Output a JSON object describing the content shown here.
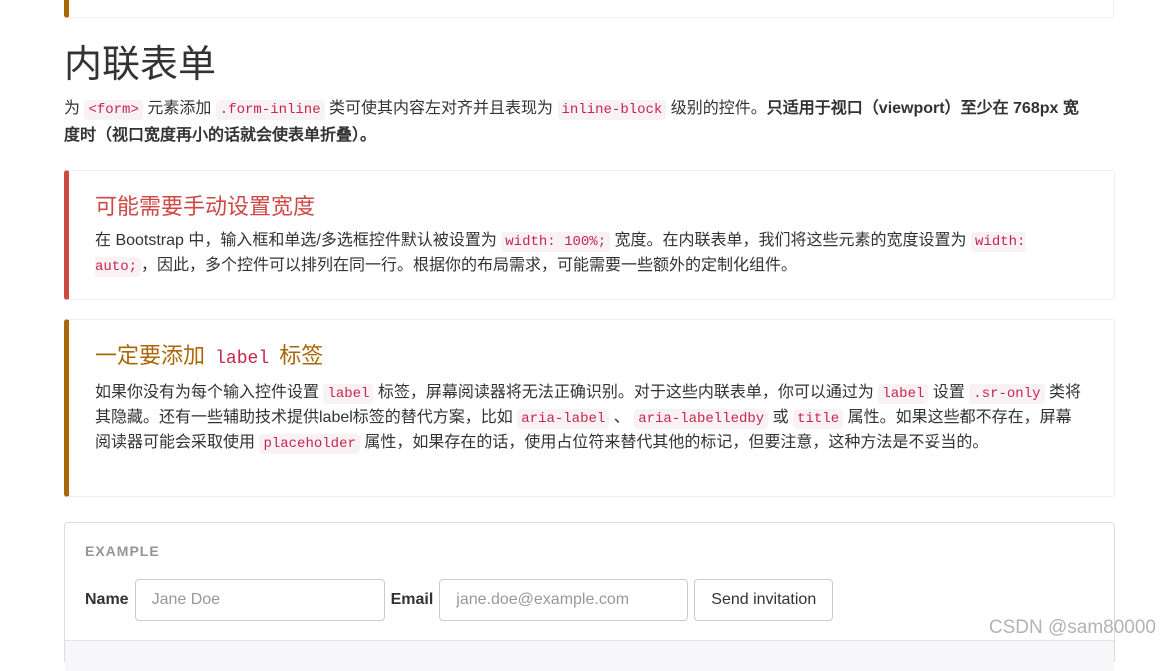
{
  "section": {
    "title": "内联表单",
    "intro": {
      "p1": "为 ",
      "code1": "<form>",
      "p2": " 元素添加 ",
      "code2": ".form-inline",
      "p3": " 类可使其内容左对齐并且表现为 ",
      "code3": "inline-block",
      "p4": " 级别的控件。",
      "strong": "只适用于视口（viewport）至少在 768px 宽度时（视口宽度再小的话就会使表单折叠）。"
    }
  },
  "callout_danger": {
    "title": "可能需要手动设置宽度",
    "t1": "在 Bootstrap 中，输入框和单选/多选框控件默认被设置为 ",
    "c1": "width: 100%;",
    "t2": " 宽度。在内联表单，我们将这些元素的宽度设置为 ",
    "c2": "width: auto;",
    "t3": "，因此，多个控件可以排列在同一行。根据你的布局需求，可能需要一些额外的定制化组件。"
  },
  "callout_warning": {
    "title_pre": "一定要添加 ",
    "title_code": "label",
    "title_post": " 标签",
    "t1": "如果你没有为每个输入控件设置 ",
    "c1": "label",
    "t2": " 标签，屏幕阅读器将无法正确识别。对于这些内联表单，你可以通过为 ",
    "c2": "label",
    "t3": " 设置 ",
    "c3": ".sr-only",
    "t4": " 类将其隐藏。还有一些辅助技术提供label标签的替代方案，比如 ",
    "c4": "aria-label",
    "t5": " 、 ",
    "c5": "aria-labelledby",
    "t6": " 或 ",
    "c6": "title",
    "t7": " 属性。如果这些都不存在，屏幕阅读器可能会采取使用 ",
    "c7": "placeholder",
    "t8": " 属性，如果存在的话，使用占位符来替代其他的标记，但要注意，这种方法是不妥当的。"
  },
  "example": {
    "label": "EXAMPLE",
    "name_label": "Name",
    "name_placeholder": "Jane Doe",
    "email_label": "Email",
    "email_placeholder": "jane.doe@example.com",
    "submit_label": "Send invitation"
  },
  "watermark": "CSDN @sam80000"
}
